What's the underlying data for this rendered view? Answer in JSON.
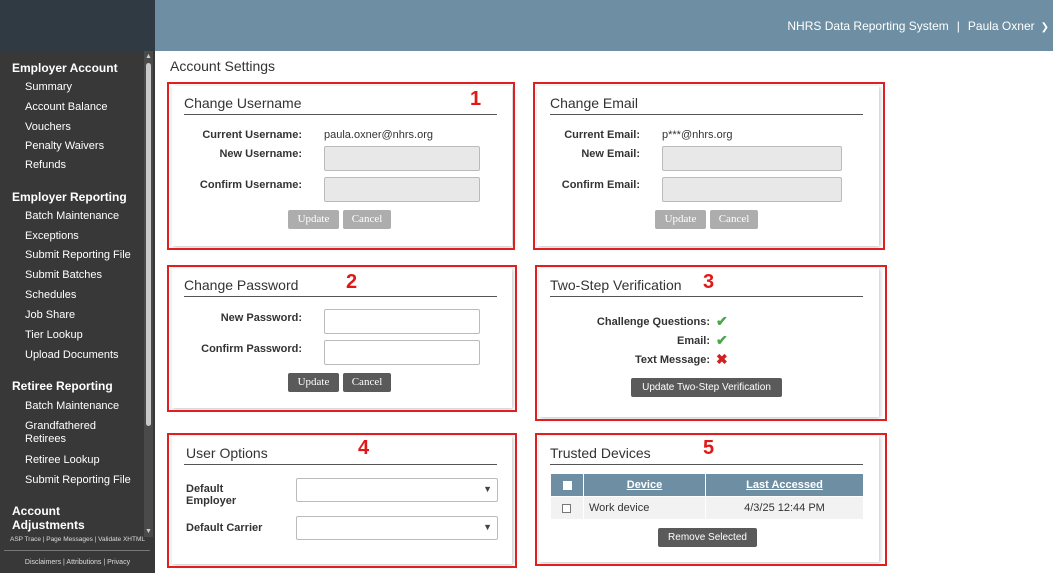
{
  "header": {
    "system_name": "NHRS Data Reporting System",
    "separator": "|",
    "user_name": "Paula Oxner",
    "user_menu_icon": "chevron-down-icon"
  },
  "sidebar": {
    "groups": [
      {
        "label": "Employer Account",
        "items": [
          "Summary",
          "Account Balance",
          "Vouchers",
          "Penalty Waivers",
          "Refunds"
        ]
      },
      {
        "label": "Employer Reporting",
        "items": [
          "Batch Maintenance",
          "Exceptions",
          "Submit Reporting File",
          "Submit Batches",
          "Schedules",
          "Job Share",
          "Tier Lookup",
          "Upload Documents"
        ]
      },
      {
        "label": "Retiree Reporting",
        "items": [
          "Batch Maintenance",
          "Grandfathered Retirees",
          "Retiree Lookup",
          "Submit Reporting File"
        ]
      },
      {
        "label": "Account Adjustments",
        "items": []
      }
    ],
    "footer_links": "ASP Trace | Page Messages | Validate XHTML",
    "footer_legal": "Disclaimers | Attributions | Privacy"
  },
  "page": {
    "title": "Account Settings"
  },
  "change_username": {
    "title": "Change Username",
    "marker": "1",
    "current_label": "Current Username:",
    "current_value": "paula.oxner@nhrs.org",
    "new_label": "New Username:",
    "new_value": "",
    "confirm_label": "Confirm Username:",
    "confirm_value": "",
    "update": "Update",
    "cancel": "Cancel"
  },
  "change_email": {
    "title": "Change Email",
    "current_label": "Current Email:",
    "current_value": "p***@nhrs.org",
    "new_label": "New Email:",
    "new_value": "",
    "confirm_label": "Confirm Email:",
    "confirm_value": "",
    "update": "Update",
    "cancel": "Cancel"
  },
  "change_password": {
    "title": "Change Password",
    "marker": "2",
    "new_label": "New Password:",
    "confirm_label": "Confirm Password:",
    "update": "Update",
    "cancel": "Cancel"
  },
  "two_step": {
    "title": "Two-Step Verification",
    "marker": "3",
    "rows": [
      {
        "label": "Challenge Questions:",
        "status": "enabled",
        "icon": "checkmark-icon"
      },
      {
        "label": "Email:",
        "status": "enabled",
        "icon": "checkmark-icon"
      },
      {
        "label": "Text Message:",
        "status": "disabled",
        "icon": "x-mark-icon"
      }
    ],
    "button": "Update Two-Step Verification"
  },
  "user_options": {
    "title": "User Options",
    "marker": "4",
    "employer_label": "Default Employer",
    "employer_value": "",
    "carrier_label": "Default Carrier",
    "carrier_value": ""
  },
  "trusted_devices": {
    "title": "Trusted Devices",
    "marker": "5",
    "columns": [
      "Device",
      "Last Accessed"
    ],
    "rows": [
      {
        "device": "Work device",
        "last_accessed": "4/3/25 12:44 PM"
      }
    ],
    "button": "Remove Selected"
  },
  "colors": {
    "topbar": "#6e8fa3",
    "sidebar": "#383838",
    "highlight": "#e02020",
    "check": "#4ca64c",
    "cross": "#d02020"
  }
}
